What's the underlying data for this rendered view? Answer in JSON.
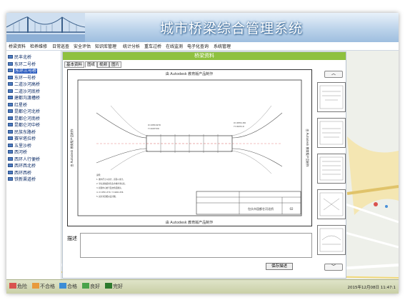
{
  "header": {
    "title": "城市桥梁综合管理系统"
  },
  "menu": [
    "桥梁资料",
    "检养维修",
    "日常巡查",
    "安全评估",
    "知识库管理",
    "统计分析",
    "重车过桥",
    "在线监测",
    "电子化查询",
    "系统管理"
  ],
  "sidebar": {
    "items": [
      {
        "label": "民丰北桥"
      },
      {
        "label": "东环二号桥"
      },
      {
        "label": "东环三号桥"
      },
      {
        "label": "东环一号桥"
      },
      {
        "label": "二道沙河高桥"
      },
      {
        "label": "二道沙河底桥"
      },
      {
        "label": "建都沟渡槽桥"
      },
      {
        "label": "红星桥"
      },
      {
        "label": "昆都仑河北桥"
      },
      {
        "label": "昆都仑河南桥"
      },
      {
        "label": "昆都仑河中桥"
      },
      {
        "label": "民族东路桥"
      },
      {
        "label": "赛罕塔拉桥"
      },
      {
        "label": "五里沙桥"
      },
      {
        "label": "西河桥"
      },
      {
        "label": "西环人行便桥"
      },
      {
        "label": "西环西北桥"
      },
      {
        "label": "西环西桥"
      },
      {
        "label": "铁新渠道桥"
      }
    ],
    "selected_index": 2
  },
  "panel": {
    "title": "桥梁资料",
    "tabs": [
      "基本资料",
      "图纸",
      "视频",
      "图片"
    ],
    "active_tab": 1,
    "drawing": {
      "header_text": "由 Autodesk 教育版产品制作",
      "footer_text": "由 Autodesk 教育版产品制作",
      "left_text": "由 Autodesk 教育版产品制作",
      "right_text": "由 Autodesk 教育版产品制作",
      "title_block": "包头市昆都仑河北桥",
      "sheet_no": "02"
    },
    "desc_label": "描述",
    "save_label": "保存描述",
    "up_label": "︿",
    "down_label": "﹀"
  },
  "legend": [
    {
      "label": "危险",
      "color": "#d9534f"
    },
    {
      "label": "不合格",
      "color": "#e89a3c"
    },
    {
      "label": "合格",
      "color": "#3c8dd6"
    },
    {
      "label": "良好",
      "color": "#4aa34a"
    },
    {
      "label": "完好",
      "color": "#2d7a2d"
    }
  ],
  "status": {
    "datetime": "2015年12月08日 11:47:1"
  }
}
